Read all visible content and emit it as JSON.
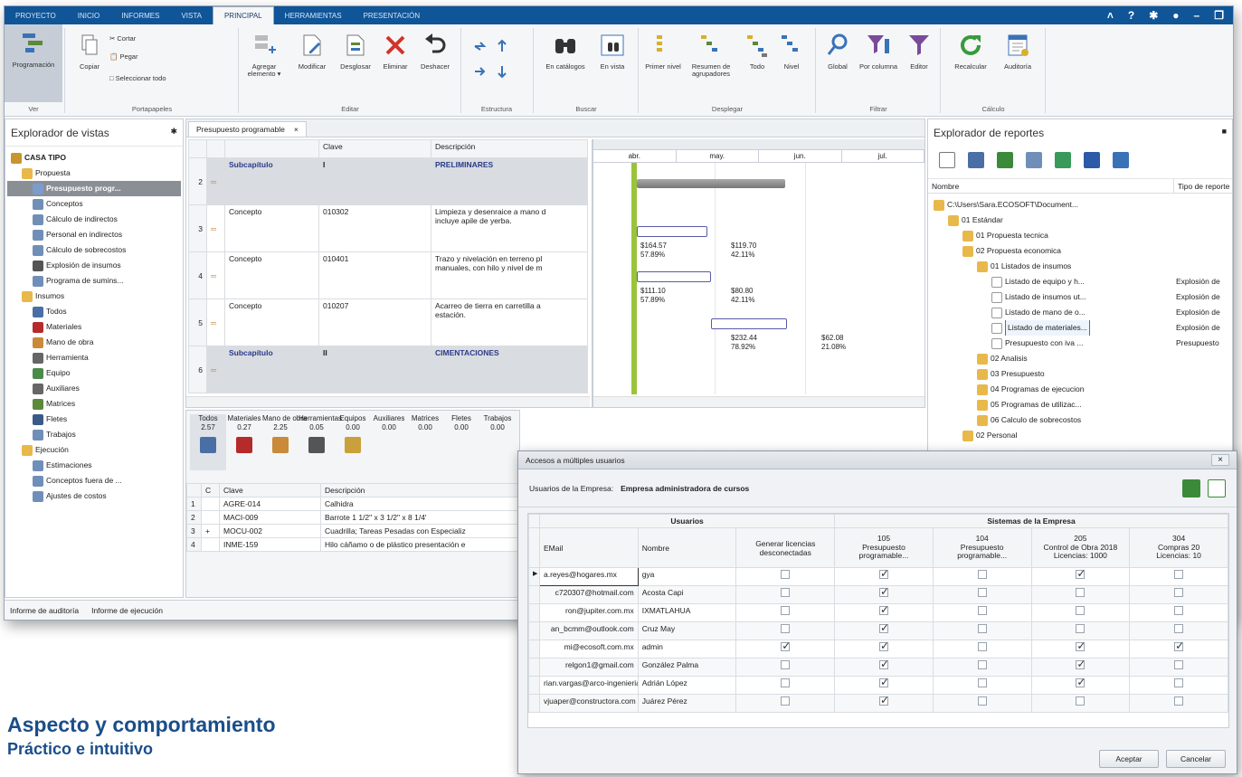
{
  "menu": {
    "tabs": [
      "PROYECTO",
      "INICIO",
      "INFORMES",
      "VISTA",
      "PRINCIPAL",
      "HERRAMIENTAS",
      "PRESENTACIÓN"
    ],
    "active": "PRINCIPAL"
  },
  "ribbon": {
    "ver": {
      "programacion": "Programación",
      "group": "Ver"
    },
    "portapapeles": {
      "copiar": "Copiar",
      "cortar": "Cortar",
      "pegar": "Pegar",
      "seleccionar": "Seleccionar todo",
      "group": "Portapapeles"
    },
    "editar": {
      "agregar": "Agregar elemento ▾",
      "modificar": "Modificar",
      "desglosar": "Desglosar",
      "eliminar": "Eliminar",
      "deshacer": "Deshacer",
      "group": "Editar"
    },
    "estructura": {
      "group": "Estructura"
    },
    "buscar": {
      "catalogos": "En catálogos",
      "vista": "En vista",
      "group": "Buscar"
    },
    "desplegar": {
      "primer": "Primer nivel",
      "resumen": "Resumen de agrupadores",
      "todo": "Todo",
      "nivel": "Nivel",
      "group": "Desplegar"
    },
    "filtrar": {
      "global": "Global",
      "columna": "Por columna",
      "editor": "Editor",
      "group": "Filtrar"
    },
    "calculo": {
      "recalcular": "Recalcular",
      "auditoria": "Auditoría",
      "group": "Cálculo"
    }
  },
  "left": {
    "title": "Explorador de vistas",
    "tree": [
      {
        "t": "CASA TIPO",
        "lvl": 0,
        "c": "#c8952f",
        "b": true
      },
      {
        "t": "Propuesta",
        "lvl": 1,
        "c": "#e8b84a"
      },
      {
        "t": "Presupuesto progr...",
        "lvl": 2,
        "c": "#7c9ccb",
        "sel": true
      },
      {
        "t": "Conceptos",
        "lvl": 2,
        "c": "#6f8fb8"
      },
      {
        "t": "Cálculo de indirectos",
        "lvl": 2,
        "c": "#6f8fb8"
      },
      {
        "t": "Personal en indirectos",
        "lvl": 2,
        "c": "#6f8fb8"
      },
      {
        "t": "Cálculo de sobrecostos",
        "lvl": 2,
        "c": "#6f8fb8"
      },
      {
        "t": "Explosión de insumos",
        "lvl": 2,
        "c": "#555"
      },
      {
        "t": "Programa de sumins...",
        "lvl": 2,
        "c": "#6f8fb8"
      },
      {
        "t": "Insumos",
        "lvl": 1,
        "c": "#e8b84a"
      },
      {
        "t": "Todos",
        "lvl": 2,
        "c": "#4a6fa5"
      },
      {
        "t": "Materiales",
        "lvl": 2,
        "c": "#b52a2a"
      },
      {
        "t": "Mano de obra",
        "lvl": 2,
        "c": "#c98a3a"
      },
      {
        "t": "Herramienta",
        "lvl": 2,
        "c": "#666"
      },
      {
        "t": "Equipo",
        "lvl": 2,
        "c": "#4a8a4a"
      },
      {
        "t": "Auxiliares",
        "lvl": 2,
        "c": "#666"
      },
      {
        "t": "Matrices",
        "lvl": 2,
        "c": "#5a8a3a"
      },
      {
        "t": "Fletes",
        "lvl": 2,
        "c": "#3a5a8a"
      },
      {
        "t": "Trabajos",
        "lvl": 2,
        "c": "#6f8fb8"
      },
      {
        "t": "Ejecución",
        "lvl": 1,
        "c": "#e8b84a"
      },
      {
        "t": "Estimaciones",
        "lvl": 2,
        "c": "#6f8fb8"
      },
      {
        "t": "Conceptos fuera de ...",
        "lvl": 2,
        "c": "#6f8fb8"
      },
      {
        "t": "Ajustes de costos",
        "lvl": 2,
        "c": "#6f8fb8"
      }
    ]
  },
  "doc": {
    "tab": "Presupuesto programable",
    "cols": [
      "Clave",
      "Descripción"
    ],
    "rows": [
      {
        "n": "2",
        "tipo": "Subcapítulo",
        "clave": "I",
        "desc": "PRELIMINARES",
        "sub": true
      },
      {
        "n": "3",
        "tipo": "Concepto",
        "clave": "010302",
        "desc": "Limpieza y desenraice a mano d",
        "desc2": "incluye apile de yerba."
      },
      {
        "n": "4",
        "tipo": "Concepto",
        "clave": "010401",
        "desc": "Trazo y nivelación en terreno pl",
        "desc2": "manuales, con hilo y nivel de m"
      },
      {
        "n": "5",
        "tipo": "Concepto",
        "clave": "010207",
        "desc": "Acarreo de tierra en carretilla a",
        "desc2": "estación."
      },
      {
        "n": "6",
        "tipo": "Subcapítulo",
        "clave": "II",
        "desc": "CIMENTACIONES",
        "sub": true
      }
    ]
  },
  "gantt": {
    "months": [
      "abr.",
      "may.",
      "jun.",
      "jul."
    ],
    "labels": [
      {
        "a": "$164.57",
        "b": "57.89%"
      },
      {
        "a": "$119.70",
        "b": "42.11%"
      },
      {
        "a": "$111.10",
        "b": "57.89%"
      },
      {
        "a": "$80.80",
        "b": "42.11%"
      },
      {
        "a": "$232.44",
        "b": "78.92%"
      },
      {
        "a": "$62.08",
        "b": "21.08%"
      }
    ]
  },
  "insumos": {
    "tabs": [
      {
        "name": "Todos",
        "val": "2.57"
      },
      {
        "name": "Materiales",
        "val": "0.27"
      },
      {
        "name": "Mano de obra",
        "val": "2.25"
      },
      {
        "name": "Herramientas",
        "val": "0.05"
      },
      {
        "name": "Equipos",
        "val": "0.00"
      },
      {
        "name": "Auxiliares",
        "val": "0.00"
      },
      {
        "name": "Matrices",
        "val": "0.00"
      },
      {
        "name": "Fletes",
        "val": "0.00"
      },
      {
        "name": "Trabajos",
        "val": "0.00"
      }
    ],
    "cols": [
      "C",
      "Clave",
      "Descripción"
    ],
    "rows": [
      {
        "n": "1",
        "c": "",
        "clave": "AGRE-014",
        "desc": "Calhidra"
      },
      {
        "n": "2",
        "c": "",
        "clave": "MACI-009",
        "desc": "Barrote 1 1/2\" x 3 1/2\" x 8 1/4'"
      },
      {
        "n": "3",
        "c": "+",
        "clave": "MOCU-002",
        "desc": "Cuadrilla; Tareas Pesadas con Especializ"
      },
      {
        "n": "4",
        "c": "",
        "clave": "INME-159",
        "desc": "Hilo cáñamo o de plástico presentación e"
      }
    ]
  },
  "status": {
    "a": "Informe de auditoría",
    "b": "Informe de ejecución"
  },
  "right": {
    "title": "Explorador de reportes",
    "cols": [
      "Nombre",
      "Tipo de reporte"
    ],
    "tree": [
      {
        "t": "C:\\Users\\Sara.ECOSOFT\\Document...",
        "lvl": 0,
        "f": true
      },
      {
        "t": "01 Estándar",
        "lvl": 1,
        "f": true
      },
      {
        "t": "01 Propuesta tecnica",
        "lvl": 2,
        "f": true
      },
      {
        "t": "02 Propuesta economica",
        "lvl": 2,
        "f": true
      },
      {
        "t": "01 Listados de insumos",
        "lvl": 3,
        "f": true
      },
      {
        "t": "Listado de equipo y h...",
        "lvl": 4,
        "r": "Explosión de"
      },
      {
        "t": "Listado de insumos ut...",
        "lvl": 4,
        "r": "Explosión de"
      },
      {
        "t": "Listado de mano de o...",
        "lvl": 4,
        "r": "Explosión de"
      },
      {
        "t": "Listado de materiales...",
        "lvl": 4,
        "r": "Explosión de",
        "sel": true
      },
      {
        "t": "Presupuesto con iva ...",
        "lvl": 4,
        "r": "Presupuesto"
      },
      {
        "t": "02 Analisis",
        "lvl": 3,
        "f": true
      },
      {
        "t": "03 Presupuesto",
        "lvl": 3,
        "f": true
      },
      {
        "t": "04 Programas de ejecucion",
        "lvl": 3,
        "f": true
      },
      {
        "t": "05 Programas de utilizac...",
        "lvl": 3,
        "f": true
      },
      {
        "t": "06 Calculo de sobrecostos",
        "lvl": 3,
        "f": true
      },
      {
        "t": "02 Personal",
        "lvl": 2,
        "f": true
      }
    ]
  },
  "dialog": {
    "title": "Accesos a múltiples usuarios",
    "empresa_label": "Usuarios de la Empresa:",
    "empresa": "Empresa administradora de cursos",
    "grp_usuarios": "Usuarios",
    "grp_sistemas": "Sistemas de la Empresa",
    "cols": [
      "EMail",
      "Nombre",
      "Generar licencias desconectadas"
    ],
    "sys": [
      {
        "a": "105",
        "b": "Presupuesto",
        "c": "programable..."
      },
      {
        "a": "104",
        "b": "Presupuesto",
        "c": "programable..."
      },
      {
        "a": "205",
        "b": "Control de Obra 2018",
        "c": "Licencias: 1000"
      },
      {
        "a": "304",
        "b": "Compras 20",
        "c": "Licencias: 10"
      }
    ],
    "rows": [
      {
        "email": "a.reyes@hogares.mx",
        "nombre": "gya",
        "g": 0,
        "s": [
          1,
          0,
          1,
          0
        ]
      },
      {
        "email": "c720307@hotmail.com",
        "nombre": "Acosta Capi",
        "g": 0,
        "s": [
          1,
          0,
          0,
          0
        ]
      },
      {
        "email": "ron@jupiter.com.mx",
        "nombre": "IXMATLAHUA",
        "g": 0,
        "s": [
          1,
          0,
          0,
          0
        ]
      },
      {
        "email": "an_bcmm@outlook.com",
        "nombre": "Cruz May",
        "g": 0,
        "s": [
          1,
          0,
          0,
          0
        ]
      },
      {
        "email": "mi@ecosoft.com.mx",
        "nombre": "admin",
        "g": 1,
        "s": [
          1,
          0,
          1,
          1
        ]
      },
      {
        "email": "relgon1@gmail.com",
        "nombre": "González Palma",
        "g": 0,
        "s": [
          1,
          0,
          1,
          0
        ]
      },
      {
        "email": "rian.vargas@arco-ingenieria....",
        "nombre": "Adrián López",
        "g": 0,
        "s": [
          1,
          0,
          1,
          0
        ]
      },
      {
        "email": "vjuaper@constructora.com",
        "nombre": "Juárez Pérez",
        "g": 0,
        "s": [
          1,
          0,
          0,
          0
        ]
      }
    ],
    "aceptar": "Aceptar",
    "cancelar": "Cancelar"
  },
  "caption": {
    "title": "Aspecto y comportamiento",
    "subtitle": "Práctico e intuitivo",
    "color": "#1a4e8a"
  }
}
